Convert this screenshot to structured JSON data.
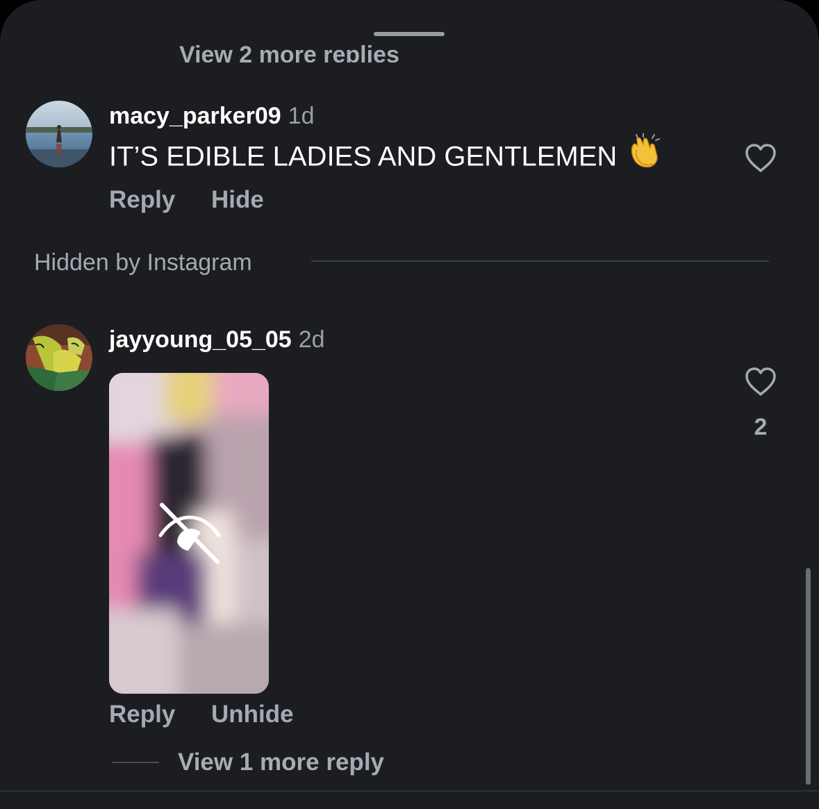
{
  "top": {
    "view_more_replies": "View 2 more replies"
  },
  "comments": [
    {
      "username": "macy_parker09",
      "time": "1d",
      "text": "IT’S EDIBLE LADIES AND GENTLEMEN",
      "emoji": "clapping-hands",
      "actions": [
        "Reply",
        "Hide"
      ]
    },
    {
      "username": "jayyoung_05_05",
      "time": "2d",
      "media": "hidden-image",
      "like_count": "2",
      "actions": [
        "Reply",
        "Unhide"
      ],
      "view_more_replies": "View 1 more reply"
    }
  ],
  "hidden_section": {
    "label": "Hidden by Instagram"
  },
  "colors": {
    "background": "#1b1d21",
    "primary_text": "#ffffff",
    "secondary_text": "#a6a9b3"
  },
  "icons": [
    "heart-icon",
    "clapping-hands-emoji",
    "hidden-eye-icon"
  ]
}
